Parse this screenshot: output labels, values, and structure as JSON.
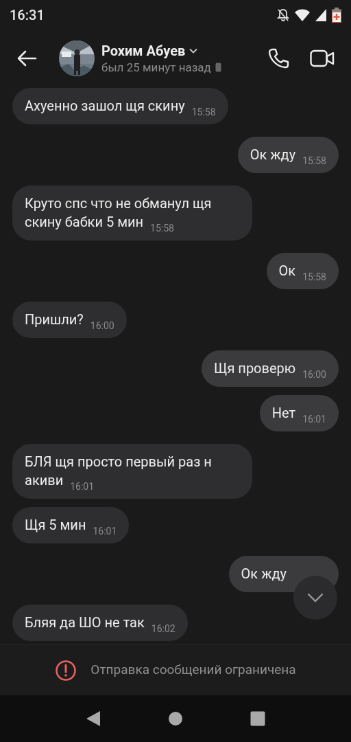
{
  "status_bar": {
    "time": "16:31"
  },
  "header": {
    "name": "Рохим Абуев",
    "last_seen": "был 25 минут назад"
  },
  "messages": [
    {
      "kind": "incoming",
      "text": "Ахуенно зашол щя скину",
      "time": "15:58"
    },
    {
      "kind": "outgoing",
      "text": "Ок жду",
      "time": "15:58"
    },
    {
      "kind": "incoming",
      "text": "Круто спс что не обманул щя скину бабки 5 мин",
      "time": "15:58"
    },
    {
      "kind": "outgoing",
      "text": "Ок",
      "time": "15:58"
    },
    {
      "kind": "incoming",
      "text": "Пришли?",
      "time": "16:00"
    },
    {
      "kind": "outgoing",
      "text": "Щя проверю",
      "time": "16:00"
    },
    {
      "kind": "outgoing",
      "text": "Нет",
      "time": "16:01"
    },
    {
      "kind": "incoming",
      "text": "БЛЯ щя просто первый раз н акиви",
      "time": "16:01"
    },
    {
      "kind": "incoming",
      "text": "Щя 5 мин",
      "time": "16:01"
    },
    {
      "kind": "outgoing",
      "text": "Ок жду"
    },
    {
      "kind": "incoming",
      "text": "Бляя да ШО не так",
      "time": "16:02"
    }
  ],
  "notice": "Отправка сообщений ограничена"
}
